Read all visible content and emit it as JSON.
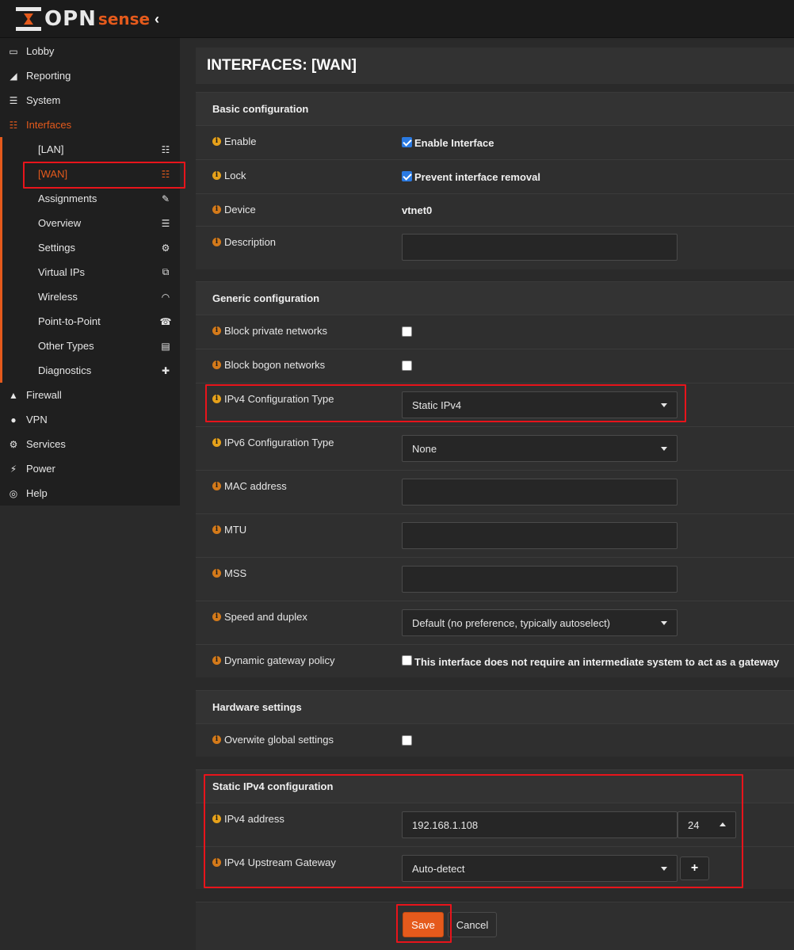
{
  "brand": {
    "name": "OPN",
    "suffix": "sense",
    "accent": "#e55a1c"
  },
  "sidebar": {
    "items": [
      {
        "label": "Lobby",
        "icon": "laptop-icon"
      },
      {
        "label": "Reporting",
        "icon": "area-chart-icon"
      },
      {
        "label": "System",
        "icon": "server-icon"
      },
      {
        "label": "Interfaces",
        "icon": "sitemap-icon"
      },
      {
        "label": "Firewall",
        "icon": "fire-icon"
      },
      {
        "label": "VPN",
        "icon": "globe-icon"
      },
      {
        "label": "Services",
        "icon": "cog-icon"
      },
      {
        "label": "Power",
        "icon": "plug-icon"
      },
      {
        "label": "Help",
        "icon": "life-ring-icon"
      }
    ],
    "interfaces_sub": [
      {
        "label": "[LAN]",
        "icon": "sitemap-icon"
      },
      {
        "label": "[WAN]",
        "icon": "sitemap-icon"
      },
      {
        "label": "Assignments",
        "icon": "pencil-icon"
      },
      {
        "label": "Overview",
        "icon": "tasks-icon"
      },
      {
        "label": "Settings",
        "icon": "cogs-icon"
      },
      {
        "label": "Virtual IPs",
        "icon": "clone-icon"
      },
      {
        "label": "Wireless",
        "icon": "wifi-icon"
      },
      {
        "label": "Point-to-Point",
        "icon": "phone-icon"
      },
      {
        "label": "Other Types",
        "icon": "archive-icon"
      },
      {
        "label": "Diagnostics",
        "icon": "medkit-icon"
      }
    ]
  },
  "page": {
    "title": "INTERFACES: [WAN]"
  },
  "basic": {
    "heading": "Basic configuration",
    "enable_label": "Enable",
    "enable_cb_label": "Enable Interface",
    "enable_checked": true,
    "lock_label": "Lock",
    "lock_cb_label": "Prevent interface removal",
    "lock_checked": true,
    "device_label": "Device",
    "device_value": "vtnet0",
    "description_label": "Description",
    "description_value": ""
  },
  "generic": {
    "heading": "Generic configuration",
    "block_private_label": "Block private networks",
    "block_private_checked": false,
    "block_bogon_label": "Block bogon networks",
    "block_bogon_checked": false,
    "ipv4_type_label": "IPv4 Configuration Type",
    "ipv4_type_value": "Static IPv4",
    "ipv6_type_label": "IPv6 Configuration Type",
    "ipv6_type_value": "None",
    "mac_label": "MAC address",
    "mac_value": "",
    "mtu_label": "MTU",
    "mtu_value": "",
    "mss_label": "MSS",
    "mss_value": "",
    "speed_label": "Speed and duplex",
    "speed_value": "Default (no preference, typically autoselect)",
    "gw_policy_label": "Dynamic gateway policy",
    "gw_policy_cb_label": "This interface does not require an intermediate system to act as a gateway",
    "gw_policy_checked": false
  },
  "hardware": {
    "heading": "Hardware settings",
    "overwrite_label": "Overwite global settings",
    "overwrite_checked": false
  },
  "static_ipv4": {
    "heading": "Static IPv4 configuration",
    "address_label": "IPv4 address",
    "address_value": "192.168.1.108",
    "prefix_value": "24",
    "gateway_label": "IPv4 Upstream Gateway",
    "gateway_value": "Auto-detect",
    "add_gateway": "+"
  },
  "actions": {
    "save": "Save",
    "cancel": "Cancel"
  }
}
